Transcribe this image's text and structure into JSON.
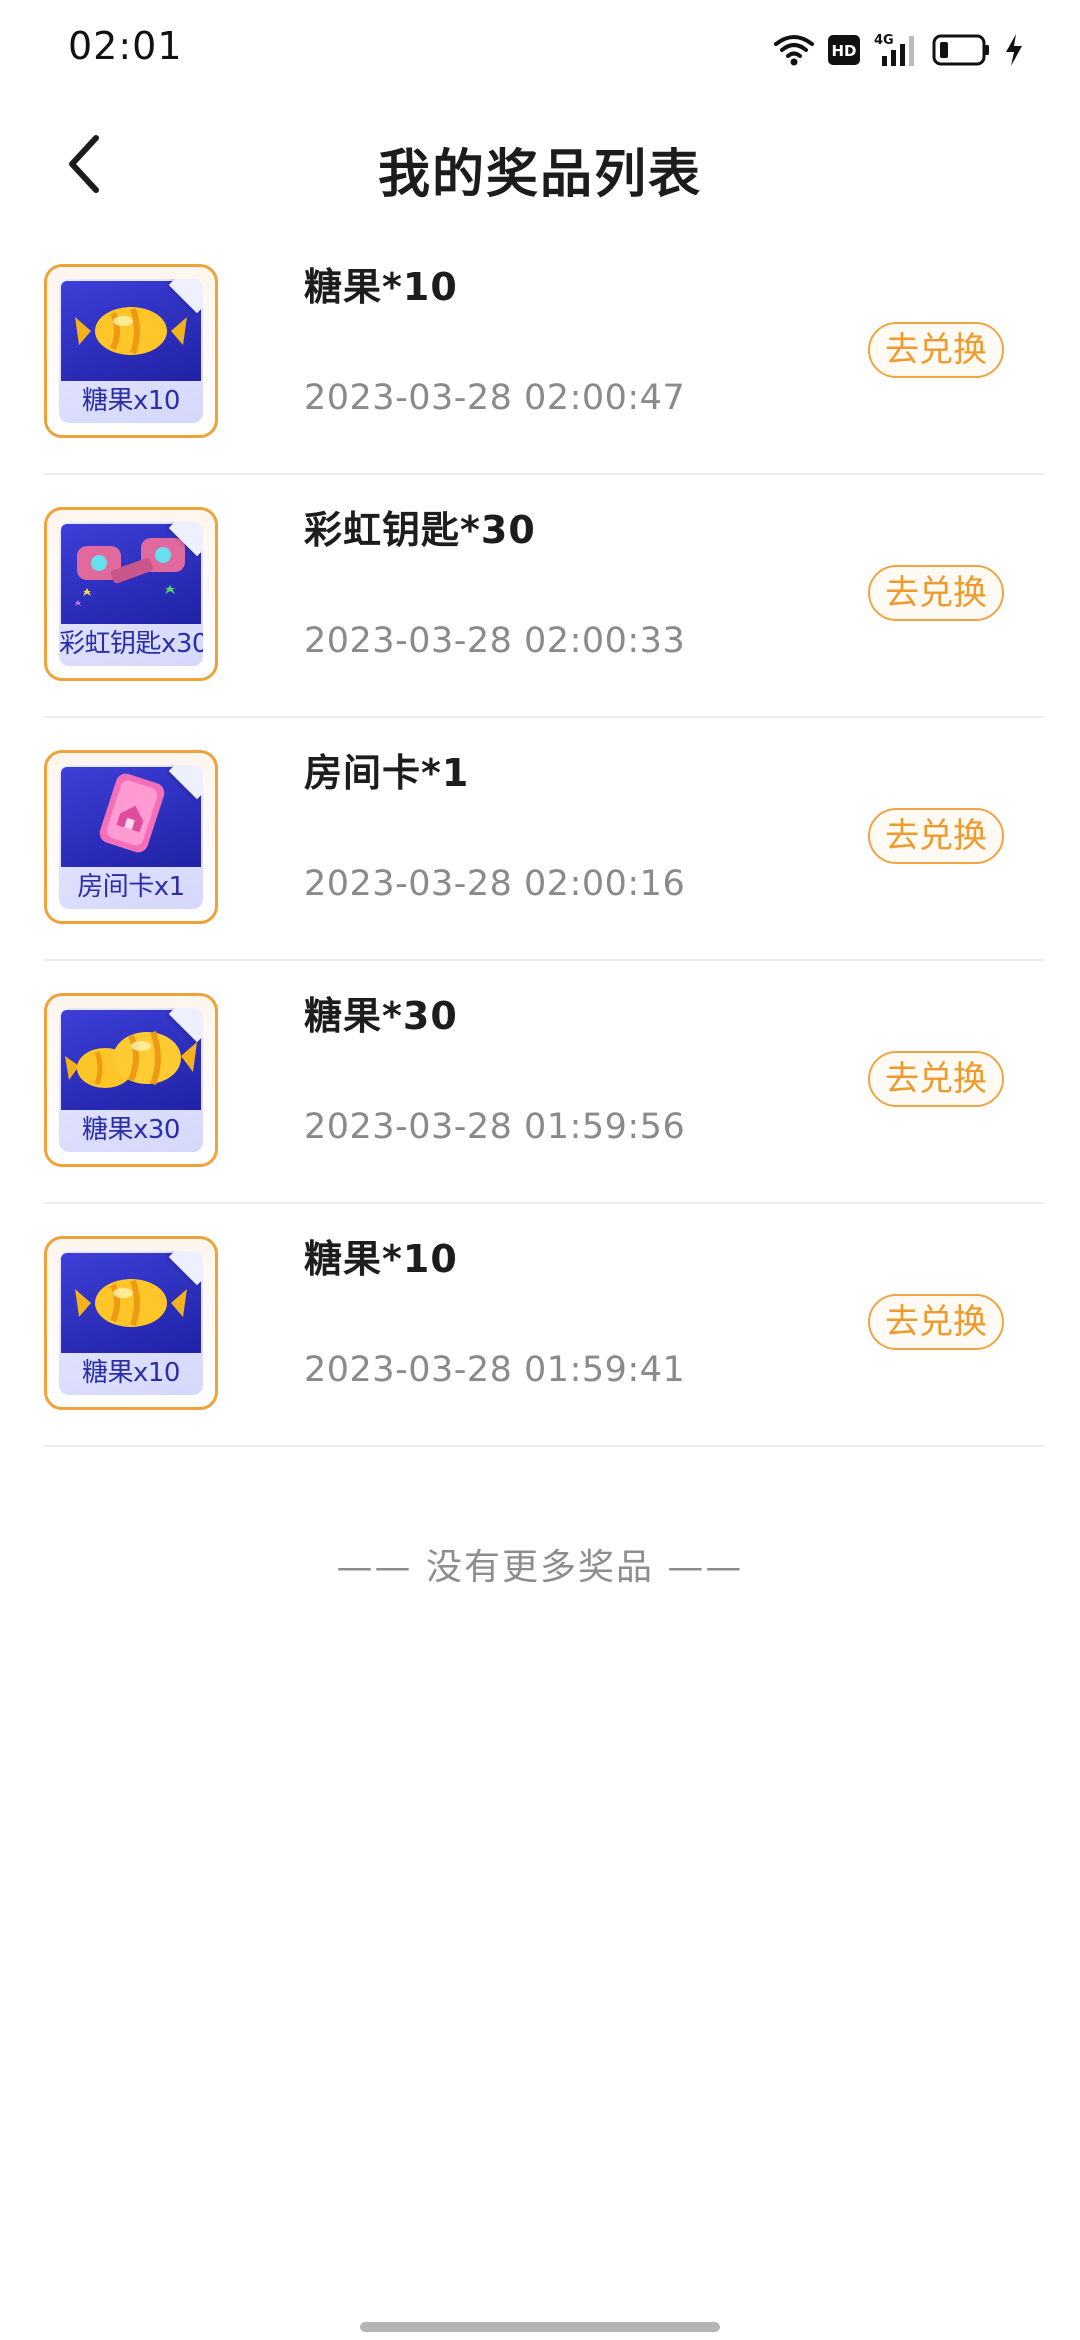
{
  "status_bar": {
    "time": "02:01",
    "icons": [
      "wifi-icon",
      "hd-icon",
      "signal-4g-icon",
      "battery-icon",
      "charging-icon"
    ],
    "network": "4G",
    "hd": "HD"
  },
  "header": {
    "title": "我的奖品列表",
    "back_icon": "chevron-left-icon"
  },
  "prizes": [
    {
      "name": "糖果*10",
      "time": "2023-03-28 02:00:47",
      "thumb_label": "糖果x10",
      "thumb_icon": "candy-icon",
      "button": "去兑换"
    },
    {
      "name": "彩虹钥匙*30",
      "time": "2023-03-28 02:00:33",
      "thumb_label": "彩虹钥匙x30",
      "thumb_icon": "rainbow-key-icon",
      "button": "去兑换"
    },
    {
      "name": "房间卡*1",
      "time": "2023-03-28 02:00:16",
      "thumb_label": "房间卡x1",
      "thumb_icon": "room-card-icon",
      "button": "去兑换"
    },
    {
      "name": "糖果*30",
      "time": "2023-03-28 01:59:56",
      "thumb_label": "糖果x30",
      "thumb_icon": "candy-pair-icon",
      "button": "去兑换"
    },
    {
      "name": "糖果*10",
      "time": "2023-03-28 01:59:41",
      "thumb_label": "糖果x10",
      "thumb_icon": "candy-icon",
      "button": "去兑换"
    }
  ],
  "footer": {
    "end_text": "—— 没有更多奖品 ——"
  },
  "colors": {
    "accent": "#EF9A2C",
    "thumb_bg": "#2A2CB8",
    "text_primary": "#1D1D1D",
    "text_secondary": "#8A8A8A"
  }
}
